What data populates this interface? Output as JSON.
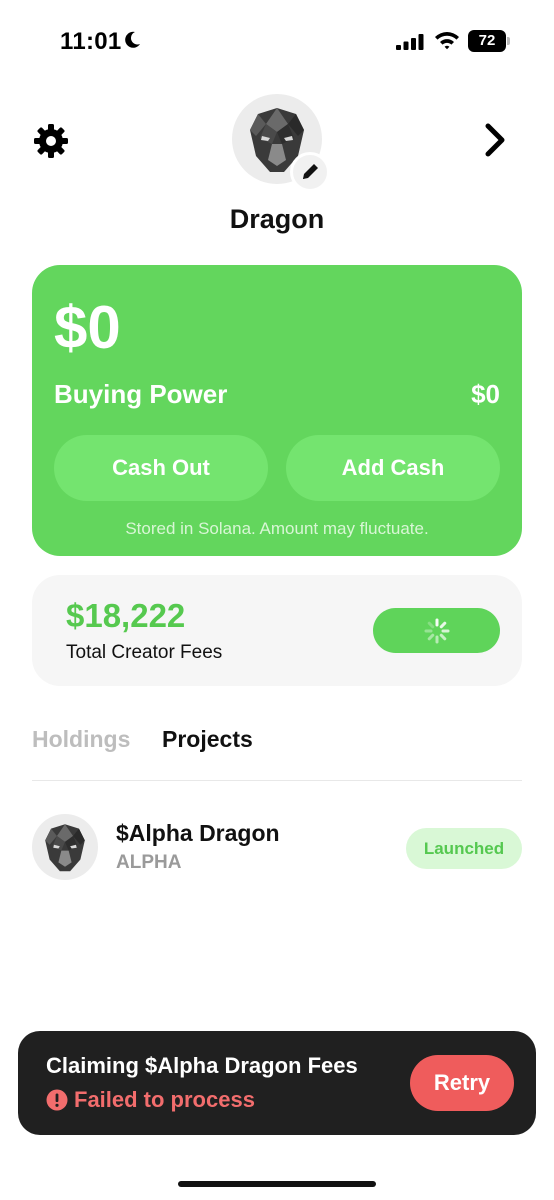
{
  "status_bar": {
    "time": "11:01",
    "battery": "72",
    "icons": [
      "moon-icon",
      "signal-icon",
      "wifi-icon",
      "battery-icon"
    ]
  },
  "header": {
    "profile_name": "Dragon",
    "icons": [
      "gear-icon",
      "chevron-right-icon",
      "pencil-icon"
    ]
  },
  "balance_card": {
    "amount": "$0",
    "buying_power_label": "Buying Power",
    "buying_power_value": "$0",
    "cash_out_label": "Cash Out",
    "add_cash_label": "Add Cash",
    "note": "Stored in Solana. Amount may fluctuate.",
    "color": "#63d65d"
  },
  "fees_card": {
    "amount": "$18,222",
    "label": "Total Creator Fees"
  },
  "tabs": [
    {
      "label": "Holdings",
      "active": false
    },
    {
      "label": "Projects",
      "active": true
    }
  ],
  "projects": [
    {
      "name": "$Alpha Dragon",
      "ticker": "ALPHA",
      "status": "Launched"
    }
  ],
  "toast": {
    "title": "Claiming $Alpha Dragon Fees",
    "error": "Failed to process",
    "retry_label": "Retry",
    "error_color": "#f26d6d"
  }
}
